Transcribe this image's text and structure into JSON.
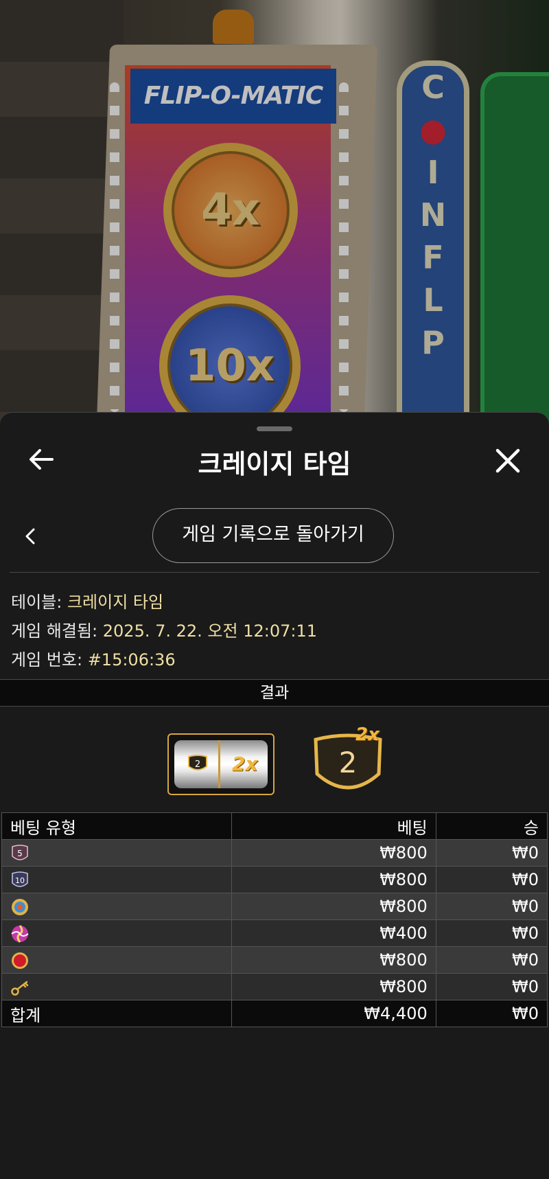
{
  "header": {
    "title": "크레이지 타임",
    "back_icon": "arrow-left-icon",
    "close_icon": "close-icon"
  },
  "history_button": {
    "label": "게임 기록으로 돌아가기",
    "chevron_icon": "chevron-left-icon"
  },
  "info": {
    "table_label": "테이블:",
    "table_value": "크레이지 타임",
    "resolved_label": "게임 해결됨:",
    "resolved_value": "2025. 7. 22. 오전 12:07:11",
    "game_no_label": "게임 번호:",
    "game_no_value": "#15:06:36"
  },
  "results": {
    "label": "결과",
    "slot_value": "2",
    "slot_multiplier": "2x",
    "outcome_value": "2",
    "outcome_multiplier": "2x"
  },
  "bets_table": {
    "columns": [
      "베팅 유형",
      "베팅",
      "승"
    ],
    "rows": [
      {
        "icon": "shield-5-icon",
        "icon_text": "5",
        "bet": "₩800",
        "win": "₩0"
      },
      {
        "icon": "shield-10-icon",
        "icon_text": "10",
        "bet": "₩800",
        "win": "₩0"
      },
      {
        "icon": "coin-flip-icon",
        "icon_text": "",
        "bet": "₩800",
        "win": "₩0"
      },
      {
        "icon": "pachinko-icon",
        "icon_text": "",
        "bet": "₩400",
        "win": "₩0"
      },
      {
        "icon": "cash-hunt-icon",
        "icon_text": "",
        "bet": "₩800",
        "win": "₩0"
      },
      {
        "icon": "crazy-time-key-icon",
        "icon_text": "",
        "bet": "₩800",
        "win": "₩0"
      }
    ],
    "total_label": "합계",
    "total_bet": "₩4,400",
    "total_win": "₩0"
  },
  "scene": {
    "booth_title": "FLIP-O-MATIC",
    "coin_top": "4x",
    "coin_bottom": "10x",
    "sign_letters": [
      "C",
      "I",
      "N",
      "F",
      "L",
      "I",
      "P"
    ]
  },
  "colors": {
    "accent_gold": "#e2b347",
    "value_text": "#f1dfa4",
    "sheet_bg": "#1a1a1a"
  }
}
